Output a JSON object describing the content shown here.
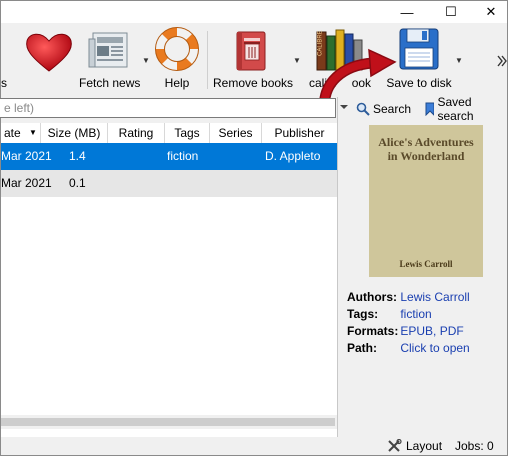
{
  "window_controls": {
    "minimize": "—",
    "maximize": "☐",
    "close": "✕"
  },
  "toolbar": {
    "partial_label": "s",
    "fetch_news": "Fetch news",
    "help": "Help",
    "remove_books": "Remove books",
    "calibre_library": "calibr",
    "calibre_library_tail": "ook",
    "save_to_disk": "Save to disk",
    "more_arrow": "⯈"
  },
  "search": {
    "placeholder": "e left)",
    "search_label": "Search",
    "saved_search_label": "Saved search"
  },
  "table": {
    "columns": [
      "ate",
      "Size (MB)",
      "Rating",
      "Tags",
      "Series",
      "Publisher"
    ],
    "rows": [
      {
        "date": "Mar 2021",
        "size": "1.4",
        "rating": "",
        "tags": "fiction",
        "series": "",
        "publisher": "D. Appleto"
      },
      {
        "date": "Mar 2021",
        "size": "0.1",
        "rating": "",
        "tags": "",
        "series": "",
        "publisher": ""
      }
    ]
  },
  "cover": {
    "title": "Alice's Adventures in Wonderland",
    "author": "Lewis Carroll"
  },
  "details": {
    "authors_label": "Authors:",
    "authors_value": "Lewis Carroll",
    "tags_label": "Tags:",
    "tags_value": "fiction",
    "formats_label": "Formats:",
    "formats_value": "EPUB, PDF",
    "path_label": "Path:",
    "path_value": "Click to open"
  },
  "status": {
    "layout": "Layout",
    "jobs": "Jobs: 0"
  },
  "colors": {
    "selection": "#0078d7",
    "alt_row": "#e6e6e6",
    "link": "#1a3fb0",
    "arrow": "#c0101a"
  }
}
